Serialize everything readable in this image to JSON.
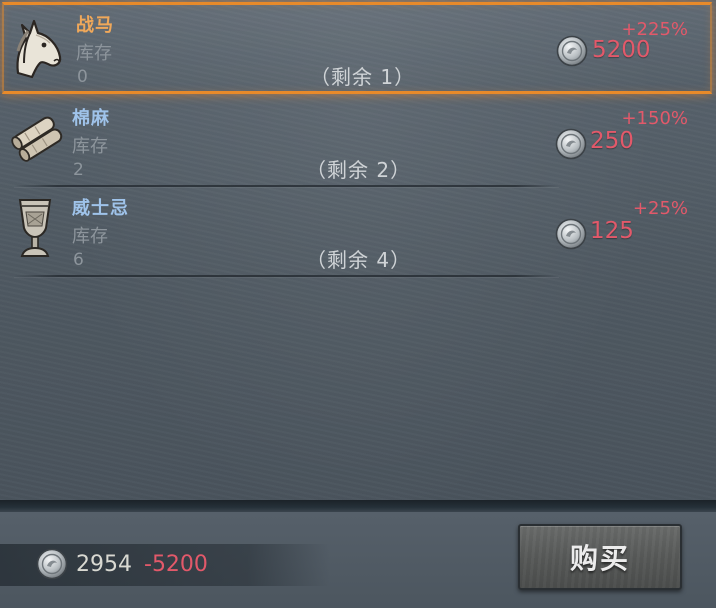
{
  "items": [
    {
      "name": "战马",
      "name_color": "#f0a85a",
      "icon": "horse-head-icon",
      "stock_label": "库存",
      "stock": "0",
      "remaining": "（剩余 1）",
      "bonus": "+225%",
      "price": "5200",
      "selected": true
    },
    {
      "name": "棉麻",
      "name_color": "#9fc3ea",
      "icon": "cloth-roll-icon",
      "stock_label": "库存",
      "stock": "2",
      "remaining": "（剩余 2）",
      "bonus": "+150%",
      "price": "250",
      "selected": false
    },
    {
      "name": "威士忌",
      "name_color": "#9fc3ea",
      "icon": "goblet-icon",
      "stock_label": "库存",
      "stock": "6",
      "remaining": "（剩余 4）",
      "bonus": "+25%",
      "price": "125",
      "selected": false
    }
  ],
  "footer": {
    "currency_icon": "silver-coin-icon",
    "balance": "2954",
    "balance_delta": "-5200",
    "buy_label": "购买"
  },
  "colors": {
    "selected_border": "#e88a2a",
    "price_red": "#e2596a",
    "rare_name": "#f0a85a",
    "common_name": "#9fc3ea"
  }
}
